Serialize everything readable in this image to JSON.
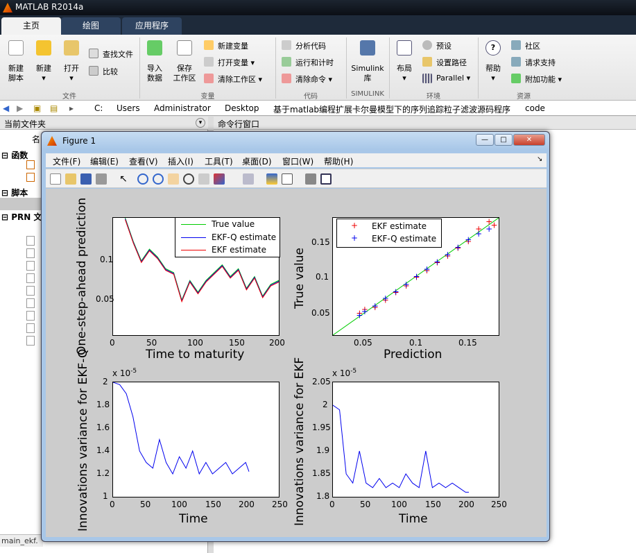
{
  "window": {
    "title": "MATLAB R2014a"
  },
  "tabs": [
    "主页",
    "绘图",
    "应用程序"
  ],
  "ribbon": {
    "big": [
      {
        "l1": "新建",
        "l2": "脚本"
      },
      {
        "l1": "新建",
        "l2": "▾"
      },
      {
        "l1": "打开",
        "l2": "▾"
      },
      {
        "l1": "导入",
        "l2": "数据"
      },
      {
        "l1": "保存",
        "l2": "工作区"
      },
      {
        "l1": "Simulink",
        "l2": "库"
      },
      {
        "l1": "布局",
        "l2": "▾"
      },
      {
        "l1": "帮助",
        "l2": "▾"
      }
    ],
    "small": [
      "查找文件",
      "比较",
      "新建变量",
      "打开变量 ▾",
      "清除工作区 ▾",
      "分析代码",
      "运行和计时",
      "清除命令 ▾",
      "预设",
      "设置路径",
      "Parallel ▾",
      "社区",
      "请求支持",
      "附加功能 ▾"
    ],
    "groups": [
      "文件",
      "变量",
      "代码",
      "SIMULINK",
      "环境",
      "资源"
    ]
  },
  "address": {
    "parts": [
      "C:",
      "Users",
      "Administrator",
      "Desktop",
      "基于matlab编程扩展卡尔曼模型下的序列追踪粒子滤波源码程序",
      "code"
    ]
  },
  "left_panel": {
    "title": "当前文件夹",
    "col": "名",
    "groups": [
      "函数",
      "脚本",
      "PRN 文"
    ]
  },
  "command_window": {
    "title": "命令行窗口"
  },
  "status": {
    "file": "main_ekf."
  },
  "figure": {
    "title": "Figure 1",
    "buttons": [
      "—",
      "□",
      "✕"
    ],
    "menus": [
      "文件(F)",
      "编辑(E)",
      "查看(V)",
      "插入(I)",
      "工具(T)",
      "桌面(D)",
      "窗口(W)",
      "帮助(H)"
    ],
    "menu_arrow": "↘"
  },
  "chart_data": [
    {
      "type": "line",
      "xlabel": "Time to maturity",
      "ylabel": "One-step-ahead prediction",
      "xlim": [
        0,
        205
      ],
      "ylim": [
        0,
        0.15
      ],
      "xticks": [
        "0",
        "50",
        "100",
        "150",
        "200"
      ],
      "yticks": [
        "0.05",
        "0.1"
      ],
      "legend": [
        "True value",
        "EKF-Q estimate",
        "EKF estimate"
      ],
      "colors": [
        "#00cc00",
        "#0000ee",
        "#ee0000"
      ],
      "series": [
        {
          "name": "True value",
          "x": [
            15,
            25,
            35,
            45,
            55,
            65,
            75,
            85,
            95,
            105,
            115,
            125,
            135,
            145,
            155,
            165,
            175,
            185,
            195,
            205
          ],
          "values": [
            0.15,
            0.12,
            0.095,
            0.11,
            0.1,
            0.085,
            0.08,
            0.045,
            0.07,
            0.055,
            0.07,
            0.08,
            0.09,
            0.075,
            0.085,
            0.06,
            0.075,
            0.05,
            0.065,
            0.07
          ]
        }
      ]
    },
    {
      "type": "scatter",
      "xlabel": "Prediction",
      "ylabel": "True value",
      "xlim": [
        0.02,
        0.18
      ],
      "ylim": [
        0.02,
        0.18
      ],
      "xticks": [
        "0.05",
        "0.1",
        "0.15"
      ],
      "yticks": [
        "0.05",
        "0.1",
        "0.15"
      ],
      "legend": [
        "EKF estimate",
        "EKF-Q estimate"
      ],
      "colors": [
        "#ee0000",
        "#0000ee"
      ],
      "series": [
        {
          "name": "EKF estimate",
          "x": [
            0.045,
            0.05,
            0.06,
            0.07,
            0.08,
            0.09,
            0.1,
            0.11,
            0.12,
            0.13,
            0.14,
            0.15,
            0.16,
            0.17,
            0.175
          ],
          "values": [
            0.05,
            0.055,
            0.058,
            0.068,
            0.078,
            0.087,
            0.099,
            0.108,
            0.119,
            0.128,
            0.139,
            0.148,
            0.165,
            0.175,
            0.17
          ]
        },
        {
          "name": "EKF-Q estimate",
          "x": [
            0.045,
            0.05,
            0.06,
            0.07,
            0.08,
            0.09,
            0.1,
            0.11,
            0.12,
            0.13,
            0.14,
            0.15,
            0.16,
            0.17
          ],
          "values": [
            0.047,
            0.052,
            0.06,
            0.07,
            0.079,
            0.089,
            0.1,
            0.11,
            0.12,
            0.13,
            0.14,
            0.15,
            0.158,
            0.165
          ]
        }
      ]
    },
    {
      "type": "line",
      "xlabel": "Time",
      "ylabel": "Innovations variance for EKF-Q",
      "exp": "x 10",
      "exp_sup": "-5",
      "xlim": [
        0,
        250
      ],
      "ylim": [
        1,
        2
      ],
      "xticks": [
        "0",
        "50",
        "100",
        "150",
        "200",
        "250"
      ],
      "yticks": [
        "1",
        "1.2",
        "1.4",
        "1.6",
        "1.8",
        "2"
      ],
      "series": [
        {
          "name": "",
          "x": [
            0,
            10,
            20,
            30,
            40,
            50,
            60,
            70,
            80,
            90,
            100,
            110,
            120,
            130,
            140,
            150,
            160,
            170,
            180,
            190,
            200,
            205
          ],
          "values": [
            2,
            1.98,
            1.9,
            1.7,
            1.4,
            1.3,
            1.25,
            1.5,
            1.3,
            1.2,
            1.35,
            1.25,
            1.4,
            1.2,
            1.3,
            1.2,
            1.25,
            1.3,
            1.2,
            1.25,
            1.3,
            1.22
          ]
        }
      ]
    },
    {
      "type": "line",
      "xlabel": "Time",
      "ylabel": "Innovations variance for EKF",
      "exp": "x 10",
      "exp_sup": "-5",
      "xlim": [
        0,
        250
      ],
      "ylim": [
        1.8,
        2.05
      ],
      "xticks": [
        "0",
        "50",
        "100",
        "150",
        "200",
        "250"
      ],
      "yticks": [
        "1.8",
        "1.85",
        "1.9",
        "1.95",
        "2",
        "2.05"
      ],
      "series": [
        {
          "name": "",
          "x": [
            0,
            10,
            20,
            30,
            40,
            50,
            60,
            70,
            80,
            90,
            100,
            110,
            120,
            130,
            140,
            150,
            160,
            170,
            180,
            190,
            200,
            205
          ],
          "values": [
            2,
            1.99,
            1.85,
            1.83,
            1.9,
            1.83,
            1.82,
            1.84,
            1.82,
            1.83,
            1.82,
            1.85,
            1.83,
            1.82,
            1.9,
            1.82,
            1.83,
            1.82,
            1.83,
            1.82,
            1.81,
            1.81
          ]
        }
      ]
    }
  ]
}
